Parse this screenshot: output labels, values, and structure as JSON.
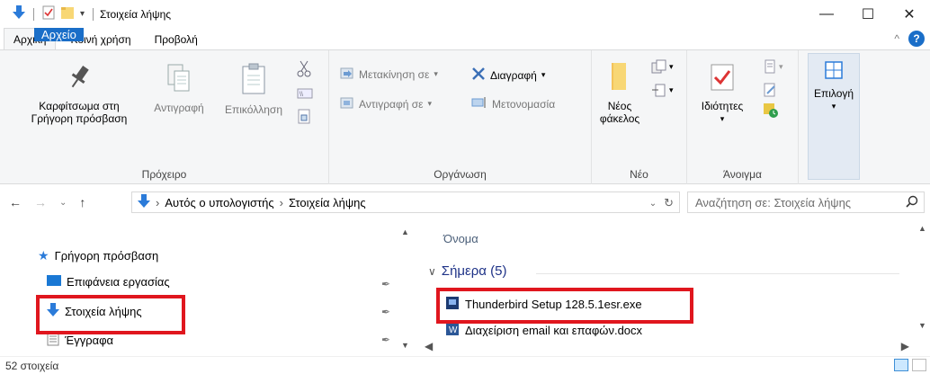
{
  "window": {
    "title": "Στοιχεία λήψης",
    "controls": {
      "minimize": "—",
      "maximize": "☐",
      "close": "✕"
    }
  },
  "tabs": [
    {
      "label": "Αρχείο"
    },
    {
      "label": "Αρχική"
    },
    {
      "label": "Κοινή χρήση"
    },
    {
      "label": "Προβολή"
    }
  ],
  "ribbon": {
    "clipboard": {
      "label": "Πρόχειρο",
      "pin_line1": "Καρφίτσωμα στη",
      "pin_line2": "Γρήγορη πρόσβαση",
      "copy": "Αντιγραφή",
      "paste": "Επικόλληση"
    },
    "organize": {
      "label": "Οργάνωση",
      "move_to": "Μετακίνηση σε",
      "copy_to": "Αντιγραφή σε",
      "delete": "Διαγραφή",
      "rename": "Μετονομασία"
    },
    "new": {
      "label": "Νέο",
      "new_folder_line1": "Νέος",
      "new_folder_line2": "φάκελος"
    },
    "open": {
      "label": "Άνοιγμα",
      "properties": "Ιδιότητες"
    },
    "select": {
      "label": "Επιλογή"
    }
  },
  "address": {
    "crumbs": [
      "Αυτός ο υπολογιστής",
      "Στοιχεία λήψης"
    ],
    "search_placeholder": "Αναζήτηση σε: Στοιχεία λήψης"
  },
  "navpane": {
    "quick_access": "Γρήγορη πρόσβαση",
    "items": [
      {
        "label": "Επιφάνεια εργασίας"
      },
      {
        "label": "Στοιχεία λήψης"
      },
      {
        "label": "Έγγραφα"
      }
    ]
  },
  "content": {
    "column_name": "Όνομα",
    "group_today": "Σήμερα (5)",
    "files": [
      {
        "name": "Thunderbird Setup 128.5.1esr.exe"
      },
      {
        "name": "Διαχείριση email και επαφών.docx"
      }
    ]
  },
  "status": {
    "item_count": "52 στοιχεία"
  },
  "colors": {
    "accent": "#1a6ec8",
    "highlight": "#e0161e",
    "group_heading": "#1e3287"
  }
}
